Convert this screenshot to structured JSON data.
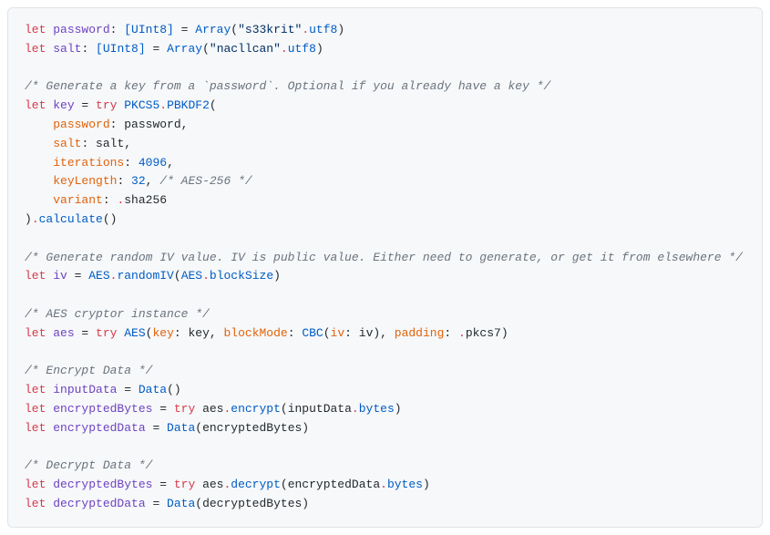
{
  "code": {
    "l1_kw1": "let",
    "l1_id": "password",
    "l1_type": "[UInt8]",
    "l1_fn": "Array",
    "l1_str": "\"s33krit\"",
    "l1_prop": "utf8",
    "l2_kw1": "let",
    "l2_id": "salt",
    "l2_type": "[UInt8]",
    "l2_fn": "Array",
    "l2_str": "\"nacllcan\"",
    "l2_prop": "utf8",
    "c1": "/* Generate a key from a `password`. Optional if you already have a key */",
    "l3_kw1": "let",
    "l3_id": "key",
    "l3_kw2": "try",
    "l3_cls": "PKCS5",
    "l3_fn": "PBKDF2",
    "l4_arg": "password",
    "l4_val": "password",
    "l5_arg": "salt",
    "l5_val": "salt",
    "l6_arg": "iterations",
    "l6_val": "4096",
    "l7_arg": "keyLength",
    "l7_val": "32",
    "l7_com": "/* AES-256 */",
    "l8_arg": "variant",
    "l8_val": "sha256",
    "l9_fn": "calculate",
    "c2": "/* Generate random IV value. IV is public value. Either need to generate, or get it from elsewhere */",
    "l10_kw1": "let",
    "l10_id": "iv",
    "l10_cls": "AES",
    "l10_fn": "randomIV",
    "l10_cls2": "AES",
    "l10_prop": "blockSize",
    "c3": "/* AES cryptor instance */",
    "l11_kw1": "let",
    "l11_id": "aes",
    "l11_kw2": "try",
    "l11_fn": "AES",
    "l11_a1": "key",
    "l11_v1": "key",
    "l11_a2": "blockMode",
    "l11_fn2": "CBC",
    "l11_a3": "iv",
    "l11_v3": "iv",
    "l11_a4": "padding",
    "l11_v4": "pkcs7",
    "c4": "/* Encrypt Data */",
    "l12_kw1": "let",
    "l12_id": "inputData",
    "l12_fn": "Data",
    "l13_kw1": "let",
    "l13_id": "encryptedBytes",
    "l13_kw2": "try",
    "l13_obj": "aes",
    "l13_fn": "encrypt",
    "l13_arg": "inputData",
    "l13_prop": "bytes",
    "l14_kw1": "let",
    "l14_id": "encryptedData",
    "l14_fn": "Data",
    "l14_arg": "encryptedBytes",
    "c5": "/* Decrypt Data */",
    "l15_kw1": "let",
    "l15_id": "decryptedBytes",
    "l15_kw2": "try",
    "l15_obj": "aes",
    "l15_fn": "decrypt",
    "l15_arg": "encryptedData",
    "l15_prop": "bytes",
    "l16_kw1": "let",
    "l16_id": "decryptedData",
    "l16_fn": "Data",
    "l16_arg": "decryptedBytes"
  }
}
